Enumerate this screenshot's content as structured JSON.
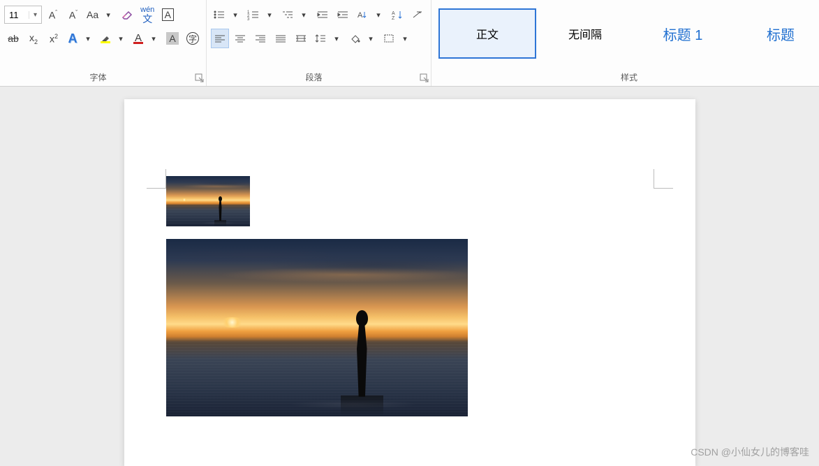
{
  "font": {
    "size": "11",
    "group_label": "字体",
    "pinyin_top": "wén",
    "pinyin_bottom": "文"
  },
  "paragraph": {
    "group_label": "段落"
  },
  "styles": {
    "group_label": "样式",
    "items": [
      {
        "label": "正文",
        "selected": true,
        "cls": ""
      },
      {
        "label": "无间隔",
        "selected": false,
        "cls": ""
      },
      {
        "label": "标题 1",
        "selected": false,
        "cls": "h1"
      },
      {
        "label": "标题",
        "selected": false,
        "cls": "h1b"
      }
    ]
  },
  "watermark": "CSDN @小仙女儿的博客哇"
}
